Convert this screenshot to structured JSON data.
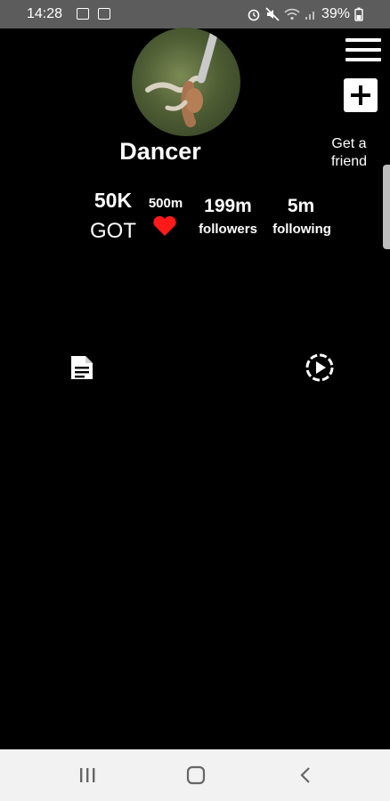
{
  "status_bar": {
    "time": "14:28",
    "battery": "39%",
    "icons": [
      "gallery-icon",
      "notification-icon",
      "alarm-icon",
      "mute-icon",
      "wifi-icon",
      "signal-icon",
      "battery-icon"
    ]
  },
  "profile": {
    "name": "Dancer",
    "avatar": "dancer-avatar"
  },
  "actions": {
    "menu_icon": "hamburger-menu-icon",
    "add_icon": "plus-icon",
    "get_friend_line1": "Get a",
    "get_friend_line2": "friend"
  },
  "stats": {
    "got_value": "50K",
    "got_label": "GOT",
    "likes_value": "500m",
    "likes_icon": "heart-icon",
    "followers_value": "199m",
    "followers_label": "followers",
    "following_value": "5m",
    "following_label": "following"
  },
  "tabs": {
    "posts_icon": "document-icon",
    "videos_icon": "play-circle-icon"
  },
  "nav_bar": {
    "recents_icon": "recents-icon",
    "home_icon": "home-icon",
    "back_icon": "back-icon"
  },
  "colors": {
    "background": "#000000",
    "status_bar": "#5c5c5c",
    "heart": "#ff1a1a",
    "nav_bar": "#f2f2f2",
    "text": "#ffffff"
  }
}
